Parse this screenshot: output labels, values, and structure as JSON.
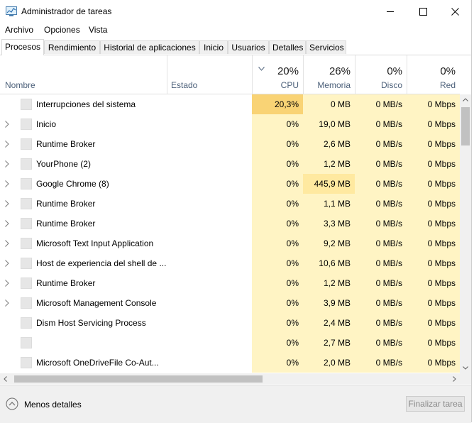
{
  "window": {
    "title": "Administrador de tareas"
  },
  "menu": [
    "Archivo",
    "Opciones",
    "Vista"
  ],
  "tabs": [
    "Procesos",
    "Rendimiento",
    "Historial de aplicaciones",
    "Inicio",
    "Usuarios",
    "Detalles",
    "Servicios"
  ],
  "active_tab": "Procesos",
  "columns": {
    "name": "Nombre",
    "status": "Estado",
    "cpu": {
      "pct": "20%",
      "label": "CPU"
    },
    "memory": {
      "pct": "26%",
      "label": "Memoria"
    },
    "disk": {
      "pct": "0%",
      "label": "Disco"
    },
    "network": {
      "pct": "0%",
      "label": "Red"
    }
  },
  "colors": {
    "heat_light": "#fff4c4",
    "heat_medium": "#ffe9a0",
    "heat_strong": "#f9d375",
    "header_text": "#4c607a"
  },
  "processes": [
    {
      "name": "Interrupciones del sistema",
      "expandable": false,
      "cpu": "20,3%",
      "memory": "0 MB",
      "disk": "0 MB/s",
      "network": "0 Mbps"
    },
    {
      "name": "Inicio",
      "expandable": true,
      "cpu": "0%",
      "memory": "19,0 MB",
      "disk": "0 MB/s",
      "network": "0 Mbps"
    },
    {
      "name": "Runtime Broker",
      "expandable": true,
      "cpu": "0%",
      "memory": "2,6 MB",
      "disk": "0 MB/s",
      "network": "0 Mbps"
    },
    {
      "name": "YourPhone (2)",
      "expandable": true,
      "cpu": "0%",
      "memory": "1,2 MB",
      "disk": "0 MB/s",
      "network": "0 Mbps"
    },
    {
      "name": "Google Chrome (8)",
      "expandable": true,
      "cpu": "0%",
      "memory": "445,9 MB",
      "disk": "0 MB/s",
      "network": "0 Mbps"
    },
    {
      "name": "Runtime Broker",
      "expandable": true,
      "cpu": "0%",
      "memory": "1,1 MB",
      "disk": "0 MB/s",
      "network": "0 Mbps"
    },
    {
      "name": "Runtime Broker",
      "expandable": true,
      "cpu": "0%",
      "memory": "3,3 MB",
      "disk": "0 MB/s",
      "network": "0 Mbps"
    },
    {
      "name": "Microsoft Text Input Application",
      "expandable": true,
      "cpu": "0%",
      "memory": "9,2 MB",
      "disk": "0 MB/s",
      "network": "0 Mbps"
    },
    {
      "name": "Host de experiencia del shell de ...",
      "expandable": true,
      "cpu": "0%",
      "memory": "10,6 MB",
      "disk": "0 MB/s",
      "network": "0 Mbps"
    },
    {
      "name": "Runtime Broker",
      "expandable": true,
      "cpu": "0%",
      "memory": "1,2 MB",
      "disk": "0 MB/s",
      "network": "0 Mbps"
    },
    {
      "name": "Microsoft Management Console",
      "expandable": true,
      "cpu": "0%",
      "memory": "3,9 MB",
      "disk": "0 MB/s",
      "network": "0 Mbps"
    },
    {
      "name": "Dism Host Servicing Process",
      "expandable": false,
      "cpu": "0%",
      "memory": "2,4 MB",
      "disk": "0 MB/s",
      "network": "0 Mbps"
    },
    {
      "name": "",
      "expandable": false,
      "cpu": "0%",
      "memory": "2,7 MB",
      "disk": "0 MB/s",
      "network": "0 Mbps"
    },
    {
      "name": "Microsoft OneDriveFile Co-Aut...",
      "expandable": false,
      "cpu": "0%",
      "memory": "2,0 MB",
      "disk": "0 MB/s",
      "network": "0 Mbps"
    }
  ],
  "footer": {
    "less_details": "Menos detalles",
    "end_task": "Finalizar tarea"
  }
}
